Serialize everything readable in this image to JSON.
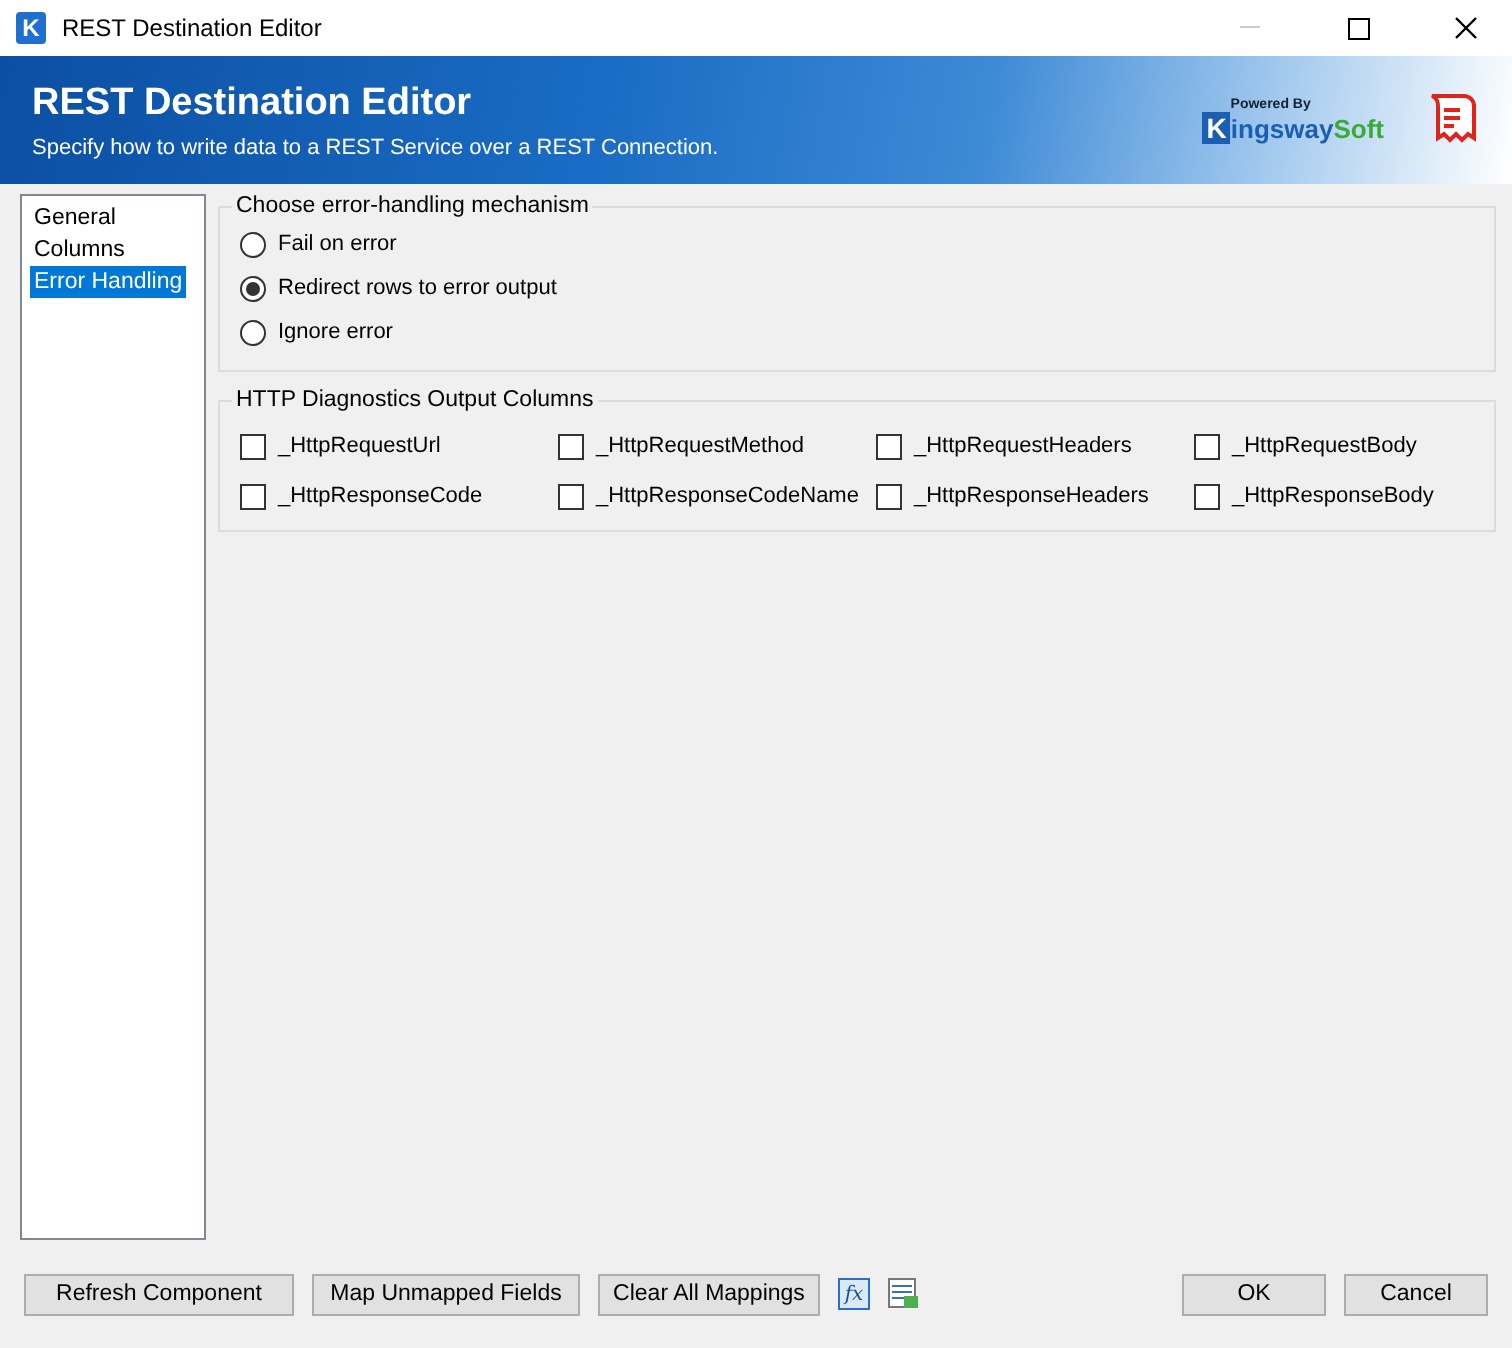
{
  "window": {
    "icon_letter": "K",
    "title": "REST Destination Editor"
  },
  "banner": {
    "title": "REST Destination Editor",
    "subtitle": "Specify how to write data to a REST Service over a REST Connection.",
    "logo": {
      "tagline": "Powered By",
      "initial": "K",
      "name": "ingsway",
      "suffix": "Soft"
    }
  },
  "sidebar": {
    "items": [
      {
        "label": "General",
        "selected": false
      },
      {
        "label": "Columns",
        "selected": false
      },
      {
        "label": "Error Handling",
        "selected": true
      }
    ]
  },
  "error_handling": {
    "title": "Choose error-handling mechanism",
    "options": [
      {
        "label": "Fail on error",
        "selected": false
      },
      {
        "label": "Redirect rows to error output",
        "selected": true
      },
      {
        "label": "Ignore error",
        "selected": false
      }
    ]
  },
  "diagnostics": {
    "title": "HTTP Diagnostics Output Columns",
    "columns": [
      {
        "label": "_HttpRequestUrl",
        "checked": false
      },
      {
        "label": "_HttpRequestMethod",
        "checked": false
      },
      {
        "label": "_HttpRequestHeaders",
        "checked": false
      },
      {
        "label": "_HttpRequestBody",
        "checked": false
      },
      {
        "label": "_HttpResponseCode",
        "checked": false
      },
      {
        "label": "_HttpResponseCodeName",
        "checked": false
      },
      {
        "label": "_HttpResponseHeaders",
        "checked": false
      },
      {
        "label": "_HttpResponseBody",
        "checked": false
      }
    ]
  },
  "footer": {
    "left_buttons": [
      "Refresh Component",
      "Map Unmapped Fields",
      "Clear All Mappings"
    ],
    "expression_icon": "fx",
    "right_buttons": [
      "OK",
      "Cancel"
    ]
  }
}
